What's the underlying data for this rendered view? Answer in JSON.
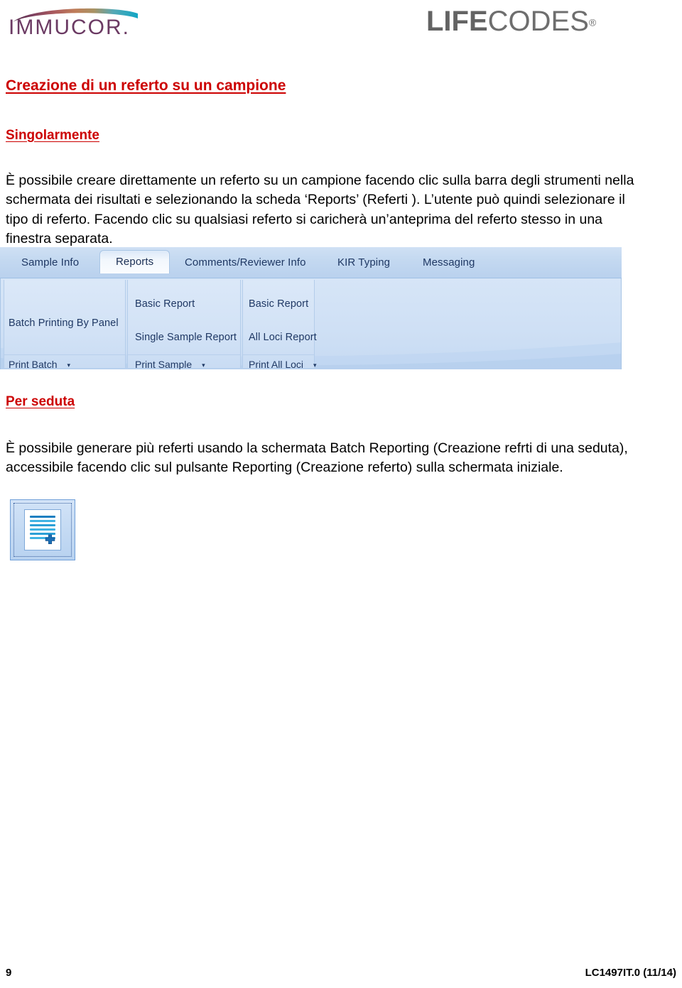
{
  "header": {
    "immucor_logo_text": "IMMUCOR",
    "immucor_logo_period": ".",
    "lifecodes_bold": "LIFE",
    "lifecodes_light": "CODES",
    "lifecodes_tm": "®",
    "immucor_arc_colors": [
      "#5b2a49",
      "#7a3f5f",
      "#a8565f",
      "#c07a5a",
      "#b9905c",
      "#7fa9a6",
      "#2fb6c9",
      "#17a9c6"
    ],
    "immucor_text_color": "#6b3a63",
    "lifecodes_color": "#6e6e6e"
  },
  "document": {
    "heading": "Creazione di un referto su un campione",
    "subheading_1": "Singolarmente",
    "paragraph_1": "È possibile creare direttamente un referto  su un campione facendo clic sulla barra degli strumenti nella schermata dei risultati e selezionando la scheda ‘Reports’ (Referti ). L’utente può quindi selezionare il tipo di referto.  Facendo clic su qualsiasi referto si caricherà un’anteprima del referto stesso in una finestra separata.",
    "subheading_2": "Per seduta",
    "paragraph_2": "È possibile generare più referti usando la schermata Batch Reporting (Creazione refrti di una seduta), accessibile facendo clic sul pulsante Reporting (Creazione referto) sulla schermata iniziale.",
    "heading_color": "#cc0000"
  },
  "app_screenshot": {
    "tabs": [
      {
        "label": "Sample Info",
        "active": false
      },
      {
        "label": "Reports",
        "active": true
      },
      {
        "label": "Comments/Reviewer Info",
        "active": false
      },
      {
        "label": "KIR Typing",
        "active": false
      },
      {
        "label": "Messaging",
        "active": false
      }
    ],
    "ribbon_groups": [
      {
        "name": "batch-printing-by-panel",
        "items": [
          "Batch Printing By Panel"
        ],
        "bottom_label": "Print Batch",
        "bottom_arrow": "▾"
      },
      {
        "name": "single-sample-reports",
        "items": [
          "Basic Report",
          "Single Sample Report"
        ],
        "bottom_label": "Print Sample",
        "bottom_arrow": "▾"
      },
      {
        "name": "all-loci-reports",
        "items": [
          "Basic Report",
          "All Loci Report"
        ],
        "bottom_label": "Print All Loci",
        "bottom_arrow": "▾"
      }
    ],
    "tab_text_color": "#1f3864",
    "ribbon_bg_color": "#cfe0f5"
  },
  "reporting_button": {
    "icon_name": "new-report-document-icon",
    "accent_color": "#2a9fd6",
    "border_color": "#6f9fd8"
  },
  "footer": {
    "page_number": "9",
    "document_code": "LC1497IT.0 (11/14)"
  }
}
